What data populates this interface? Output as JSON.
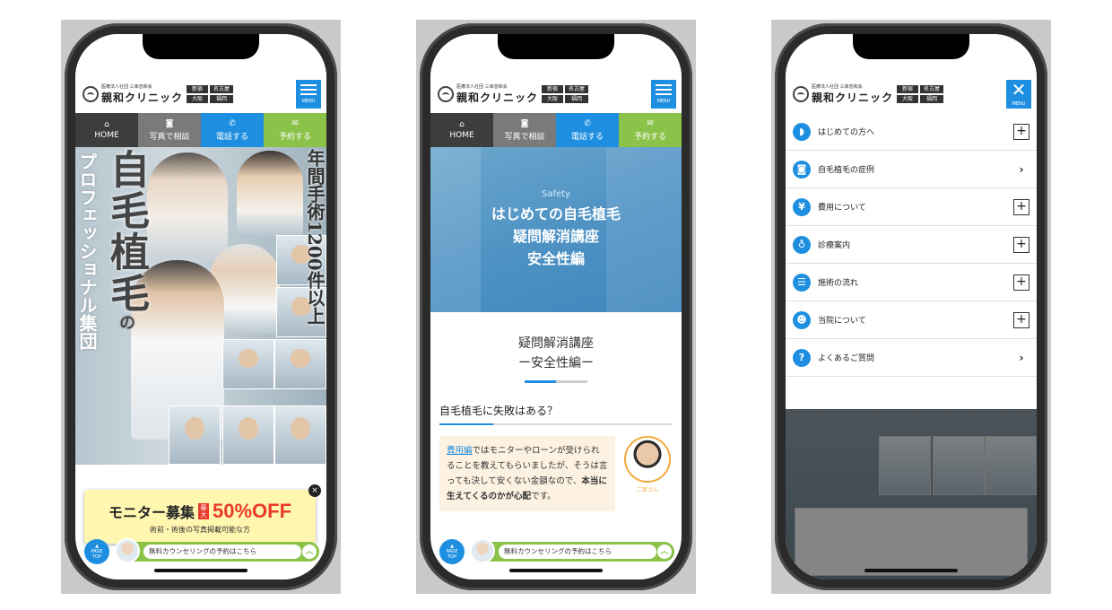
{
  "colors": {
    "brand_blue": "#1e8fe0",
    "green": "#8bc34a",
    "promo_red": "#e83a2e",
    "dark": "#3d3d3d"
  },
  "header": {
    "logo_sub": "医療法人社団 三幸音和会",
    "logo_main": "親和クリニック",
    "branches": [
      "新宿",
      "名古屋",
      "大阪",
      "福岡"
    ],
    "menu_label": "MENU"
  },
  "nav": [
    {
      "label": "HOME",
      "icon": "home-icon",
      "glyph": "⌂"
    },
    {
      "label": "写真で相談",
      "icon": "camera-icon",
      "glyph": "◙"
    },
    {
      "label": "電話する",
      "icon": "phone-icon",
      "glyph": "✆"
    },
    {
      "label": "予約する",
      "icon": "mail-icon",
      "glyph": "✉"
    }
  ],
  "phone1": {
    "hero_main": "自毛植毛の",
    "hero_main_big1": "自",
    "hero_main_big2": "毛",
    "hero_main_big3": "植",
    "hero_main_big4": "毛",
    "hero_main_no": "の",
    "hero_left": "プロフェッショナル集団",
    "hero_right": "年間手術1200件以上",
    "promo_label": "モニター募集",
    "promo_badge": "最大",
    "promo_pct": "50%OFF",
    "promo_sub": "術前・術後の写真掲載可能な方",
    "promo_close": "×"
  },
  "cta": {
    "page_top_1": "PAGE",
    "page_top_2": "TOP",
    "text": "無料カウンセリングの予約はこちら",
    "chevron": "︿"
  },
  "phone2": {
    "kicker": "Safety",
    "title_1": "はじめての自毛植毛",
    "title_2": "疑問解消講座",
    "title_3": "安全性編",
    "section_1": "疑問解消講座",
    "section_2": "ー安全性編ー",
    "question": "自毛植毛に失敗はある？",
    "body_link": "費用編",
    "body_1": "ではモニターやローンが受けられることを教えてもらいましたが、そうは言っても決して安くない金額なので、",
    "body_bold": "本当に生えてくるのかが心配",
    "body_2": "です。",
    "profile_name": "二宮さん"
  },
  "phone3": {
    "menu_close": "MENU",
    "items": [
      {
        "label": "はじめての方へ",
        "icon": "shield-icon",
        "glyph": "◗",
        "action": "+"
      },
      {
        "label": "自毛植毛の症例",
        "icon": "camera-icon",
        "glyph": "◙",
        "action": "›"
      },
      {
        "label": "費用について",
        "icon": "yen-icon",
        "glyph": "¥",
        "action": "+"
      },
      {
        "label": "診療案内",
        "icon": "stethoscope-icon",
        "glyph": "♁",
        "action": "+"
      },
      {
        "label": "施術の流れ",
        "icon": "list-icon",
        "glyph": "☰",
        "action": "+"
      },
      {
        "label": "当院について",
        "icon": "people-icon",
        "glyph": "☻",
        "action": "+"
      },
      {
        "label": "よくあるご質問",
        "icon": "question-icon",
        "glyph": "?",
        "action": "›"
      }
    ]
  }
}
